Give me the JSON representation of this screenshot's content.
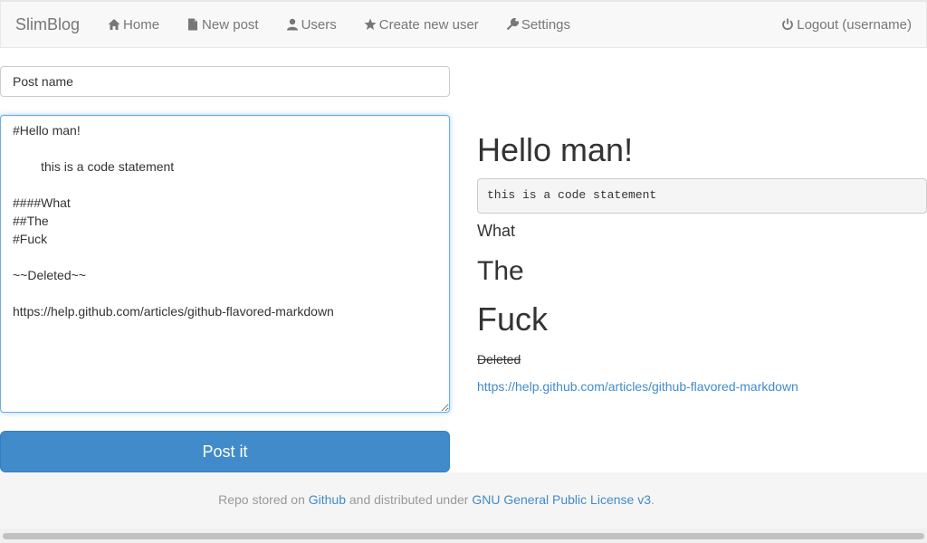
{
  "navbar": {
    "brand": "SlimBlog",
    "items": [
      {
        "label": "Home",
        "icon": "home-icon"
      },
      {
        "label": "New post",
        "icon": "file-icon"
      },
      {
        "label": "Users",
        "icon": "user-icon"
      },
      {
        "label": "Create new user",
        "icon": "star-icon"
      },
      {
        "label": "Settings",
        "icon": "wrench-icon"
      }
    ],
    "logout": {
      "label": "Logout (username)",
      "icon": "power-icon"
    }
  },
  "form": {
    "post_name_placeholder": "Post name",
    "editor_value": "#Hello man!\n\n        this is a code statement\n\n####What\n##The\n#Fuck\n\n~~Deleted~~\n\nhttps://help.github.com/articles/github-flavored-markdown",
    "submit_label": "Post it"
  },
  "preview": {
    "h1": "Hello man!",
    "code": "this is a code statement",
    "h4": "What",
    "h2": "The",
    "h1b": "Fuck",
    "deleted": "Deleted",
    "link": "https://help.github.com/articles/github-flavored-markdown"
  },
  "footer": {
    "prefix": "Repo stored on ",
    "github": "Github",
    "middle": " and distributed under ",
    "license": "GNU General Public License v3",
    "suffix": "."
  },
  "colors": {
    "accent": "#428bca",
    "navbar_bg": "#f8f8f8",
    "footer_bg": "#f5f5f5"
  }
}
